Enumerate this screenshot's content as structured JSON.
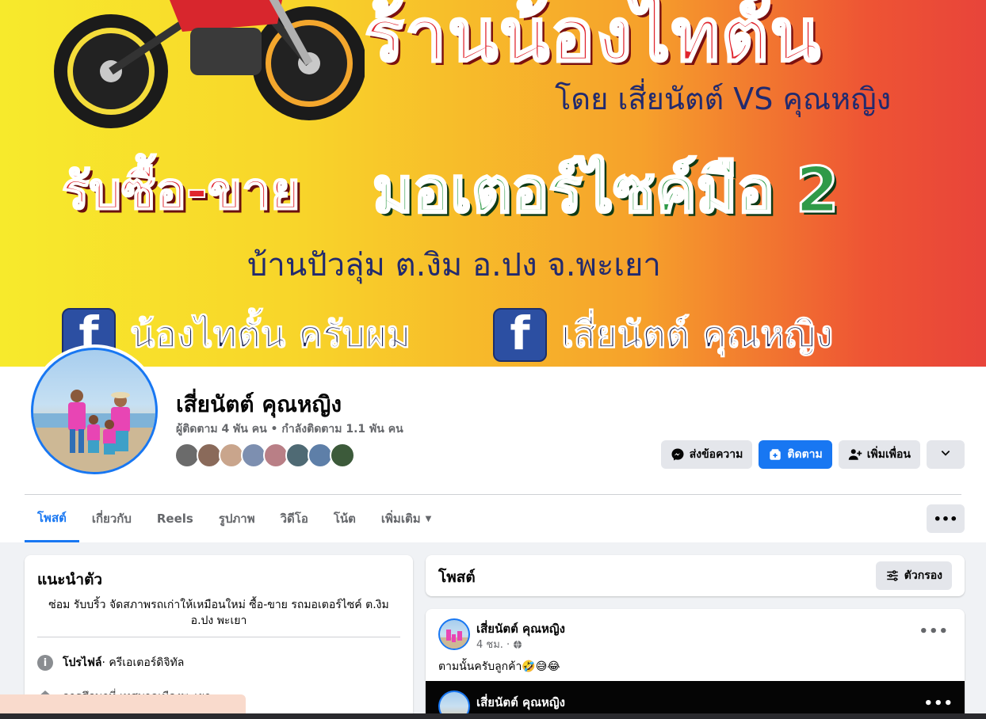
{
  "cover": {
    "shop_name": "ร้านน้องไทตั้น",
    "by_line": "โดย เสี่ยนัตต์ VS คุณหญิง",
    "buy_sell": "รับซื้อ-ขาย",
    "motorcycle": "มอเตอร์ไซค์มือ 2",
    "address": "บ้านปัวลุ่ม ต.งิม อ.ปง จ.พะเยา",
    "fb_page_1": "น้องไทตั้น ครับผม",
    "fb_page_2": "เสี่ยนัตต์ คุณหญิง",
    "fb_letter": "f"
  },
  "profile": {
    "name": "เสี่ยนัตต์ คุณหญิง",
    "stats": "ผู้ติดตาม 4 พัน คน • กำลังติดตาม 1.1 พัน คน",
    "friend_colors": [
      "#6b6b6b",
      "#8a6a5a",
      "#c9a58c",
      "#7d8fb0",
      "#b97f86",
      "#4f6a74",
      "#5e7fa8",
      "#3c5a3a"
    ]
  },
  "actions": {
    "message": "ส่งข้อความ",
    "follow": "ติดตาม",
    "add_friend": "เพิ่มเพื่อน"
  },
  "tabs": [
    {
      "label": "โพสต์"
    },
    {
      "label": "เกี่ยวกับ"
    },
    {
      "label": "Reels"
    },
    {
      "label": "รูปภาพ"
    },
    {
      "label": "วิดีโอ"
    },
    {
      "label": "โน้ต"
    },
    {
      "label": "เพิ่มเติม"
    }
  ],
  "intro": {
    "title": "แนะนำตัว",
    "bio": "ซ่อม รับบริ้ว จัดสภาพรถเก่าให้เหมือนใหม่ ซื้อ-ขาย รถมอเตอร์ไซค์ ต.งิม อ.ปง พะเยา",
    "profile_label": "โปรไฟล์",
    "profile_value": " · ครีเอเตอร์ดิจิทัล",
    "work_row": "การศึกษาที่ เทศบาลเมืองพะเยา"
  },
  "posts": {
    "title": "โพสต์",
    "filter": "ตัวกรอง"
  },
  "post": {
    "author": "เสี่ยนัตต์ คุณหญิง",
    "time": "4 ชม. ·",
    "text": "ตามนั้นครับลูกค้า🤣😅😂",
    "shared_author": "เสี่ยนัตต์ คุณหญิง"
  },
  "colors": {
    "accent": "#1877f2",
    "page_bg": "#f0f2f5"
  }
}
